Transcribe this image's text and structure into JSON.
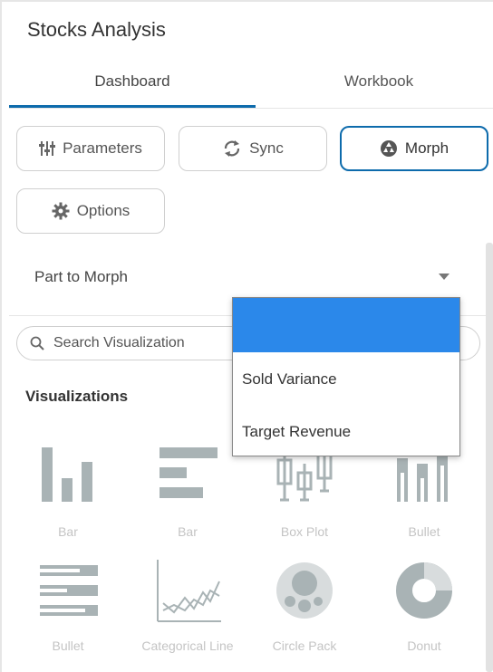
{
  "title": "Stocks Analysis",
  "tabs": [
    {
      "label": "Dashboard",
      "active": true
    },
    {
      "label": "Workbook",
      "active": false
    }
  ],
  "buttons": {
    "parameters": "Parameters",
    "sync": "Sync",
    "morph": "Morph",
    "options": "Options"
  },
  "part_to_morph": {
    "label": "Part to Morph"
  },
  "search": {
    "placeholder": "Search Visualization"
  },
  "visualizations": {
    "heading": "Visualizations",
    "items": [
      {
        "label": "Bar",
        "icon": "bar-chart-vertical-icon"
      },
      {
        "label": "Bar",
        "icon": "bar-chart-horizontal-icon"
      },
      {
        "label": "Box Plot",
        "icon": "box-plot-icon"
      },
      {
        "label": "Bullet",
        "icon": "bullet-vertical-icon"
      },
      {
        "label": "Bullet",
        "icon": "bullet-horizontal-icon"
      },
      {
        "label": "Categorical Line",
        "icon": "categorical-line-icon"
      },
      {
        "label": "Circle Pack",
        "icon": "circle-pack-icon"
      },
      {
        "label": "Donut",
        "icon": "donut-icon"
      }
    ]
  },
  "dropdown": {
    "selected": "",
    "options": [
      "Sold Variance",
      "Target Revenue"
    ]
  },
  "colors": {
    "accent": "#0d6bac",
    "selected_option": "#2b88ea",
    "icon_gray": "#9aa4a6",
    "label_gray": "#c4c4c4"
  }
}
